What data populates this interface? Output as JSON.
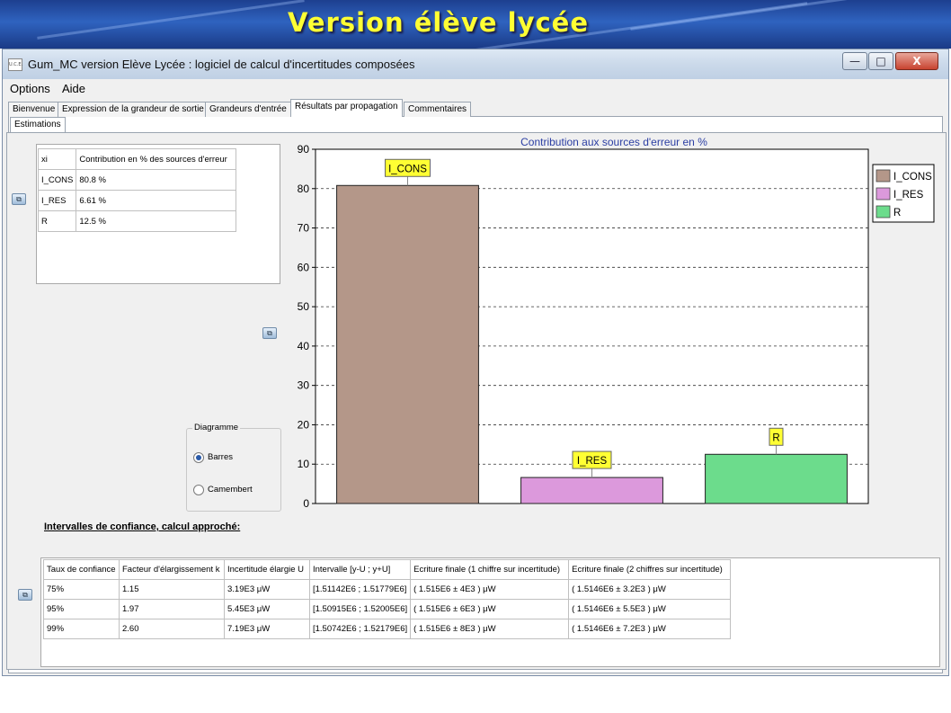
{
  "banner": {
    "title": "Version élève lycée"
  },
  "window": {
    "icon_text": "U.C.E.",
    "title": "Gum_MC version Elève Lycée : logiciel de calcul d'incertitudes composées",
    "minimize": "—",
    "maximize": "□",
    "close": "X"
  },
  "menu": {
    "options": "Options",
    "aide": "Aide"
  },
  "tabs": [
    {
      "label": "Bienvenue"
    },
    {
      "label": "Expression de la grandeur de sortie"
    },
    {
      "label": "Grandeurs d'entrée"
    },
    {
      "label": "Résultats par propagation"
    },
    {
      "label": "Commentaires"
    }
  ],
  "subtab": {
    "label": "Estimations"
  },
  "contributions": {
    "headers": [
      "xi",
      "Contribution en % des sources d'erreur"
    ],
    "rows": [
      [
        "I_CONS",
        "80.8 %"
      ],
      [
        "I_RES",
        "6.61 %"
      ],
      [
        "R",
        "12.5 %"
      ]
    ]
  },
  "diagramme": {
    "title": "Diagramme",
    "option_bars": "Barres",
    "option_pie": "Camembert",
    "selected": "Barres"
  },
  "chart_data": {
    "type": "bar",
    "title": "Contribution aux sources d'erreur en %",
    "categories": [
      "I_CONS",
      "I_RES",
      "R"
    ],
    "values": [
      80.8,
      6.61,
      12.5
    ],
    "colors": [
      "#b49789",
      "#dc99dc",
      "#6cdc8c"
    ],
    "ylim": [
      0,
      90
    ],
    "yticks": [
      0,
      10,
      20,
      30,
      40,
      50,
      60,
      70,
      80,
      90
    ],
    "legend": [
      "I_CONS",
      "I_RES",
      "R"
    ],
    "legend_position": "top-right",
    "grid": "horizontal dashed",
    "xlabel": "",
    "ylabel": ""
  },
  "intervals": {
    "title": "Intervalles de confiance, calcul approché:",
    "headers": [
      "Taux de confiance",
      "Facteur d'élargissement k",
      "Incertitude élargie U",
      "Intervalle [y-U ; y+U]",
      "Ecriture finale (1 chiffre sur incertitude)",
      "Ecriture finale (2 chiffres sur incertitude)"
    ],
    "rows": [
      [
        "75%",
        "1.15",
        "3.19E3 μW",
        "[1.51142E6 ; 1.51779E6]",
        "( 1.515E6 ± 4E3 ) μW",
        "( 1.5146E6 ± 3.2E3 ) μW"
      ],
      [
        "95%",
        "1.97",
        "5.45E3 μW",
        "[1.50915E6 ; 1.52005E6]",
        "( 1.515E6 ± 6E3 ) μW",
        "( 1.5146E6 ± 5.5E3 ) μW"
      ],
      [
        "99%",
        "2.60",
        "7.19E3 μW",
        "[1.50742E6 ; 1.52179E6]",
        "( 1.515E6 ± 8E3 ) μW",
        "( 1.5146E6 ± 7.2E3 ) μW"
      ]
    ]
  }
}
